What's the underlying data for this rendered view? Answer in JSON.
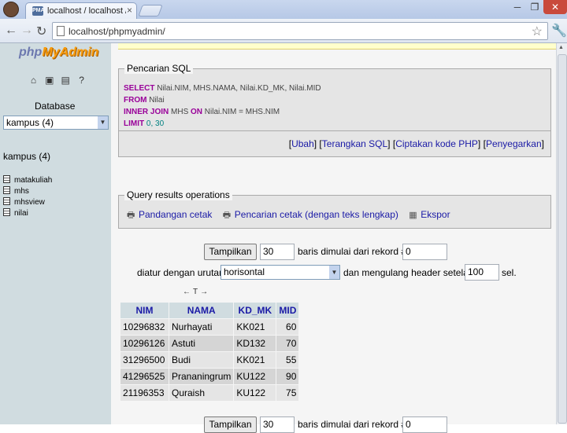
{
  "browser": {
    "tab_title": "localhost / localhost / kampus",
    "tab_close": "×",
    "favicon_text": "PMA",
    "url": "localhost/phpmyadmin/",
    "btn_min": "─",
    "btn_max": "❐",
    "btn_close": "✕",
    "nav_back": "←",
    "nav_forward": "→",
    "nav_reload": "↻",
    "star": "☆",
    "wrench": "🔧"
  },
  "sidebar": {
    "logo_php": "php",
    "logo_ma": "MyAdmin",
    "icons": [
      "home-icon",
      "sql-icon",
      "query-window-icon",
      "docs-icon"
    ],
    "icon_glyphs": [
      "⌂",
      "▣",
      "▤",
      "?"
    ],
    "database_label": "Database",
    "database_select": "kampus (4)",
    "db_name": "kampus (4)",
    "tables": [
      "matakuliah",
      "mhs",
      "mhsview",
      "nilai"
    ]
  },
  "sql": {
    "legend": "Pencarian SQL",
    "lines": [
      {
        "kw": "SELECT",
        "rest": " Nilai.NIM, MHS.NAMA, Nilai.KD_MK, Nilai.MID"
      },
      {
        "kw": "FROM",
        "rest": " Nilai"
      },
      {
        "kw": "INNER JOIN",
        "rest_pre": " MHS ",
        "kw2": "ON",
        "rest": " Nilai.NIM = MHS.NIM"
      },
      {
        "kw": "LIMIT",
        "rest": " ",
        "num": "0, 30"
      }
    ],
    "links": [
      "Ubah",
      "Terangkan SQL",
      "Ciptakan kode PHP",
      "Penyegarkan"
    ]
  },
  "query_results": {
    "legend": "Query results operations",
    "links": [
      "Pandangan cetak",
      "Pencarian cetak (dengan teks lengkap)",
      "Ekspor"
    ]
  },
  "nav": {
    "show_button": "Tampilkan",
    "rows_value": "30",
    "rows_label": "baris dimulai dari rekord #",
    "start_value": "0",
    "order_label": "diatur dengan urutan",
    "order_value": "horisontal",
    "repeat_label": "dan mengulang header setelah",
    "repeat_value": "100",
    "cells_label": "sel."
  },
  "table": {
    "sort_arrows": "←T→",
    "columns": [
      "NIM",
      "NAMA",
      "KD_MK",
      "MID"
    ],
    "rows": [
      [
        "10296832",
        "Nurhayati",
        "KK021",
        "60"
      ],
      [
        "10296126",
        "Astuti",
        "KD132",
        "70"
      ],
      [
        "31296500",
        "Budi",
        "KK021",
        "55"
      ],
      [
        "41296525",
        "Prananingrum",
        "KU122",
        "90"
      ],
      [
        "21196353",
        "Quraish",
        "KU122",
        "75"
      ]
    ]
  },
  "nav_bottom": {
    "show_button": "Tampilkan",
    "rows_value": "30",
    "rows_label": "baris dimulai dari rekord #",
    "start_value": "0"
  }
}
